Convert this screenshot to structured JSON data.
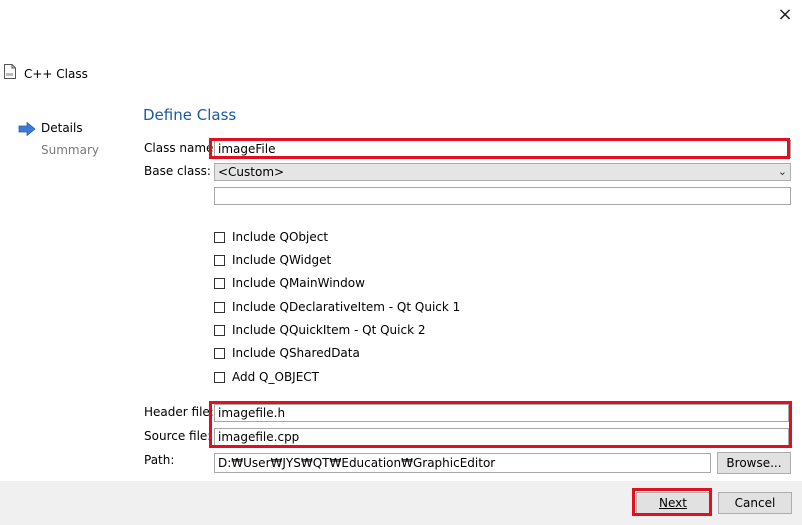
{
  "window": {
    "close_glyph": "×",
    "wizard_title": "C++ Class"
  },
  "steps": [
    {
      "label": "Details",
      "active": true
    },
    {
      "label": "Summary",
      "active": false
    }
  ],
  "page": {
    "title": "Define Class"
  },
  "form": {
    "class_name_label": "Class name:",
    "class_name_value": "imageFile",
    "base_class_label": "Base class:",
    "base_class_value": "<Custom>",
    "custom_base_value": "",
    "header_file_label": "Header file:",
    "header_file_value": "imagefile.h",
    "source_file_label": "Source file:",
    "source_file_value": "imagefile.cpp",
    "path_label": "Path:",
    "path_value": "D:₩User₩JYS₩QT₩Education₩GraphicEditor",
    "browse_label": "Browse..."
  },
  "options": [
    {
      "label": "Include QObject",
      "checked": false
    },
    {
      "label": "Include QWidget",
      "checked": false
    },
    {
      "label": "Include QMainWindow",
      "checked": false
    },
    {
      "label": "Include QDeclarativeItem - Qt Quick 1",
      "checked": false
    },
    {
      "label": "Include QQuickItem - Qt Quick 2",
      "checked": false
    },
    {
      "label": "Include QSharedData",
      "checked": false
    },
    {
      "label": "Add Q_OBJECT",
      "checked": false
    }
  ],
  "buttons": {
    "next_label": "Next",
    "cancel_label": "Cancel"
  },
  "colors": {
    "highlight": "#e01020",
    "title_blue": "#1a5aa3",
    "step_arrow": "#3a7bd5"
  }
}
